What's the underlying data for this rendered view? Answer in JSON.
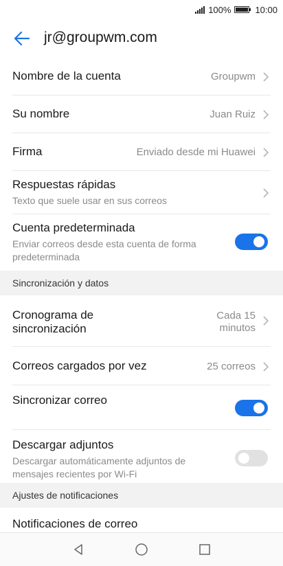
{
  "status": {
    "battery": "100%",
    "time": "10:00"
  },
  "header": {
    "title": "jr@groupwm.com"
  },
  "account": {
    "name_label": "Nombre de la cuenta",
    "name_value": "Groupwm",
    "your_name_label": "Su nombre",
    "your_name_value": "Juan Ruiz",
    "signature_label": "Firma",
    "signature_value": "Enviado desde mi Huawei",
    "quick_replies_label": "Respuestas rápidas",
    "quick_replies_desc": "Texto que suele usar en sus correos",
    "default_label": "Cuenta predeterminada",
    "default_desc_1": "Enviar correos desde esta cuenta de forma",
    "default_desc_2": "predeterminada",
    "default_on": true
  },
  "sync_section": {
    "header": "Sincronización y datos",
    "schedule_label_1": "Cronograma de",
    "schedule_label_2": "sincronización",
    "schedule_value_1": "Cada 15",
    "schedule_value_2": "minutos",
    "load_label": "Correos cargados por vez",
    "load_value": "25 correos",
    "sync_label": "Sincronizar correo",
    "sync_on": true,
    "attachments_label": "Descargar adjuntos",
    "attachments_desc_1": "Descargar automáticamente adjuntos de",
    "attachments_desc_2": "mensajes recientes por Wi-Fi",
    "attachments_on": false
  },
  "notifications_section": {
    "header": "Ajustes de notificaciones",
    "mail_notifications_label": "Notificaciones de correo"
  },
  "colors": {
    "accent": "#1a73e8",
    "toggle_off": "#e1e1e1"
  },
  "icons": [
    "back-arrow-icon",
    "chevron-right-icon",
    "nav-back-icon",
    "nav-home-icon",
    "nav-recents-icon"
  ]
}
